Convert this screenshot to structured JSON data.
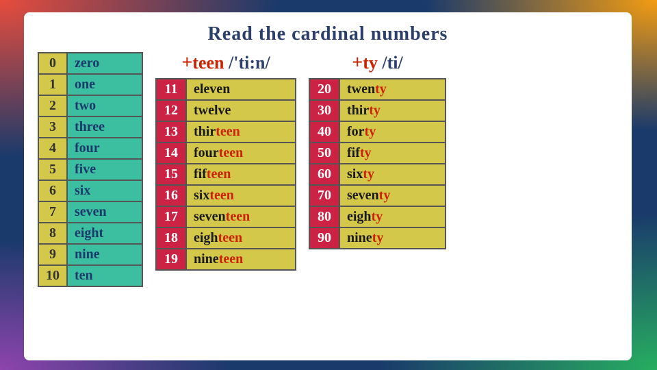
{
  "title": "Read the cardinal numbers",
  "basic": {
    "header_teen": "+teen /'ti:n/",
    "header_ty": "+ty /ti/",
    "rows": [
      {
        "num": "0",
        "word": "zero"
      },
      {
        "num": "1",
        "word": "one"
      },
      {
        "num": "2",
        "word": "two"
      },
      {
        "num": "3",
        "word": "three"
      },
      {
        "num": "4",
        "word": "four"
      },
      {
        "num": "5",
        "word": "five"
      },
      {
        "num": "6",
        "word": "six"
      },
      {
        "num": "7",
        "word": "seven"
      },
      {
        "num": "8",
        "word": "eight"
      },
      {
        "num": "9",
        "word": "nine"
      },
      {
        "num": "10",
        "word": "ten"
      }
    ]
  },
  "teen": [
    {
      "num": "11",
      "word": "eleven",
      "base": "eleven",
      "suffix": ""
    },
    {
      "num": "12",
      "word": "twelve",
      "base": "twelve",
      "suffix": ""
    },
    {
      "num": "13",
      "word": "thirteen",
      "base": "thir",
      "suffix": "teen"
    },
    {
      "num": "14",
      "word": "fourteen",
      "base": "four",
      "suffix": "teen"
    },
    {
      "num": "15",
      "word": "fifteen",
      "base": "fif",
      "suffix": "teen"
    },
    {
      "num": "16",
      "word": "sixteen",
      "base": "six",
      "suffix": "teen"
    },
    {
      "num": "17",
      "word": "seventeen",
      "base": "seven",
      "suffix": "teen"
    },
    {
      "num": "18",
      "word": "eighteen",
      "base": "eigh",
      "suffix": "teen"
    },
    {
      "num": "19",
      "word": "nineteen",
      "base": "nine",
      "suffix": "teen"
    }
  ],
  "ty": [
    {
      "num": "20",
      "word": "twenty",
      "base": "twen",
      "suffix": "ty"
    },
    {
      "num": "30",
      "word": "thirty",
      "base": "thir",
      "suffix": "ty"
    },
    {
      "num": "40",
      "word": "forty",
      "base": "for",
      "suffix": "ty"
    },
    {
      "num": "50",
      "word": "fifty",
      "base": "fif",
      "suffix": "ty"
    },
    {
      "num": "60",
      "word": "sixty",
      "base": "six",
      "suffix": "ty"
    },
    {
      "num": "70",
      "word": "seventy",
      "base": "seven",
      "suffix": "ty"
    },
    {
      "num": "80",
      "word": "eighty",
      "base": "eigh",
      "suffix": "ty"
    },
    {
      "num": "90",
      "word": "ninety",
      "base": "nine",
      "suffix": "ty"
    }
  ]
}
